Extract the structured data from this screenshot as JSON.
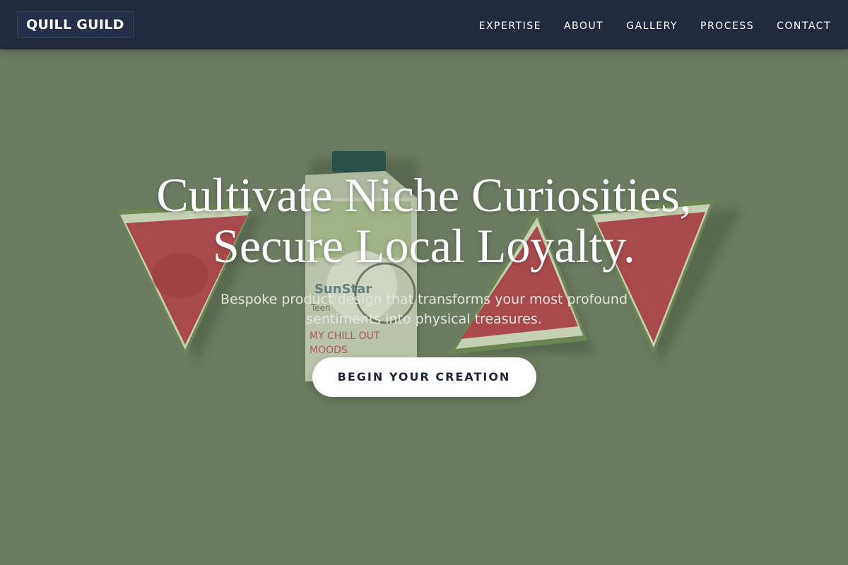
{
  "brand": {
    "name": "QUILL GUILD"
  },
  "nav": {
    "items": [
      {
        "label": "EXPERTISE"
      },
      {
        "label": "ABOUT"
      },
      {
        "label": "GALLERY"
      },
      {
        "label": "PROCESS"
      },
      {
        "label": "CONTACT"
      }
    ]
  },
  "hero": {
    "title_line1": "Cultivate Niche Curiosities,",
    "title_line2": "Secure Local Loyalty.",
    "subtitle": "Bespoke product design that transforms your most profound sentiments into physical treasures.",
    "cta_label": "BEGIN YOUR CREATION",
    "image": {
      "carton_brand": "SunStar",
      "carton_line": "Teen",
      "carton_slogan_1": "MY CHILL OUT",
      "carton_slogan_2": "MOODS"
    }
  },
  "colors": {
    "navbar_bg": "#222b3d",
    "hero_bg": "#6f7f64",
    "cta_bg": "#ffffff",
    "cta_text": "#1c2435"
  }
}
